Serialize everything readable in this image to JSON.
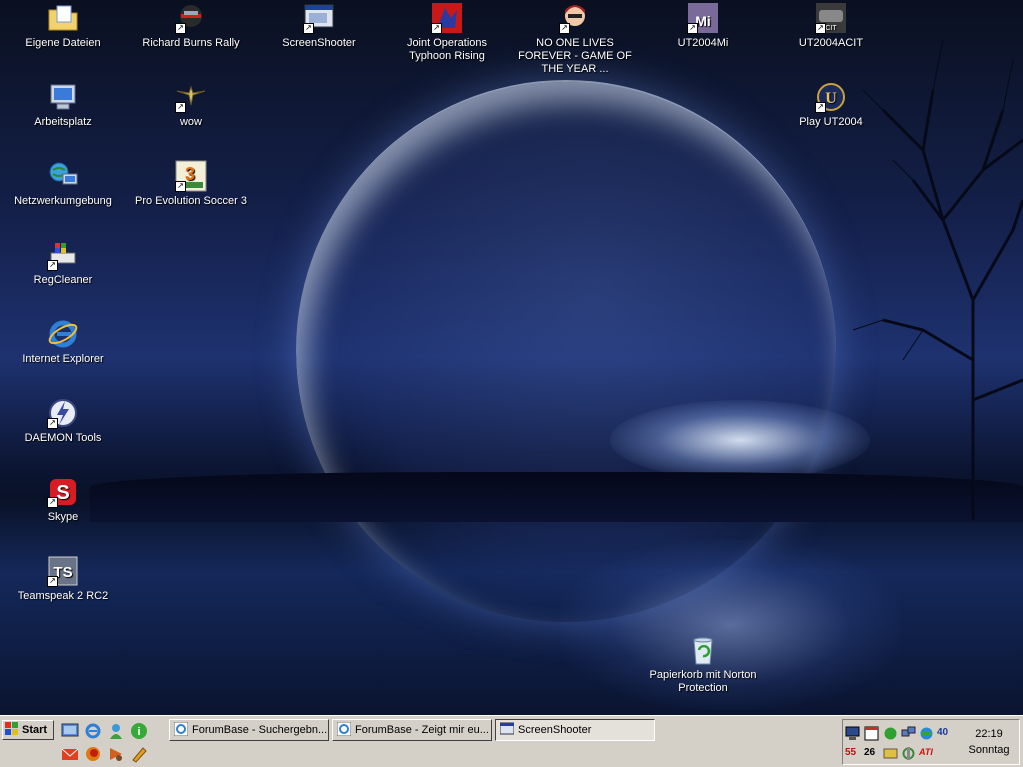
{
  "desktop": {
    "icons": [
      {
        "label": "Eigene Dateien",
        "icon": "my-documents-folder-icon",
        "shortcut": false
      },
      {
        "label": "Arbeitsplatz",
        "icon": "my-computer-icon",
        "shortcut": false
      },
      {
        "label": "Netzwerkumgebung",
        "icon": "network-places-icon",
        "shortcut": false
      },
      {
        "label": "RegCleaner",
        "icon": "regcleaner-icon",
        "shortcut": true
      },
      {
        "label": "Internet Explorer",
        "icon": "internet-explorer-icon",
        "shortcut": false
      },
      {
        "label": "DAEMON Tools",
        "icon": "daemon-tools-icon",
        "shortcut": true
      },
      {
        "label": "Skype",
        "icon": "skype-icon",
        "shortcut": true
      },
      {
        "label": "Teamspeak 2 RC2",
        "icon": "teamspeak-icon",
        "shortcut": true
      },
      {
        "label": "Richard Burns Rally",
        "icon": "richard-burns-rally-icon",
        "shortcut": true
      },
      {
        "label": "wow",
        "icon": "wow-icon",
        "shortcut": true
      },
      {
        "label": "Pro Evolution Soccer 3",
        "icon": "pes3-icon",
        "shortcut": true
      },
      {
        "label": "ScreenShooter",
        "icon": "screenshooter-icon",
        "shortcut": true
      },
      {
        "label": "Joint Operations Typhoon Rising",
        "icon": "joint-operations-icon",
        "shortcut": true
      },
      {
        "label": "NO ONE LIVES FOREVER - GAME OF THE YEAR ...",
        "icon": "nolf-icon",
        "shortcut": true
      },
      {
        "label": "UT2004Mi",
        "icon": "ut2004mi-icon",
        "shortcut": true
      },
      {
        "label": "UT2004ACIT",
        "icon": "ut2004acit-icon",
        "shortcut": true
      },
      {
        "label": "Play UT2004",
        "icon": "play-ut2004-icon",
        "shortcut": true
      },
      {
        "label": "Papierkorb mit Norton Protection",
        "icon": "recycle-bin-icon",
        "shortcut": false
      }
    ]
  },
  "taskbar": {
    "start_label": "Start",
    "quick_launch": [
      "show-desktop-icon",
      "internet-explorer-icon",
      "messenger-icon",
      "info-icon",
      "mail-icon",
      "firefox-icon",
      "media-icon",
      "misc-icon"
    ],
    "tasks": [
      {
        "label": "ForumBase - Suchergebn...",
        "icon": "ie-window-icon"
      },
      {
        "label": "ForumBase - Zeigt mir eu...",
        "icon": "ie-window-icon"
      },
      {
        "label": "ScreenShooter",
        "icon": "screenshooter-window-icon"
      }
    ],
    "tray": {
      "time": "22:19",
      "day": "Sonntag",
      "texts": [
        "40",
        "55",
        "26",
        "ATI"
      ]
    }
  },
  "colors": {
    "taskbar": "#d4d0c8",
    "desktop_accent": "#1e3270"
  }
}
